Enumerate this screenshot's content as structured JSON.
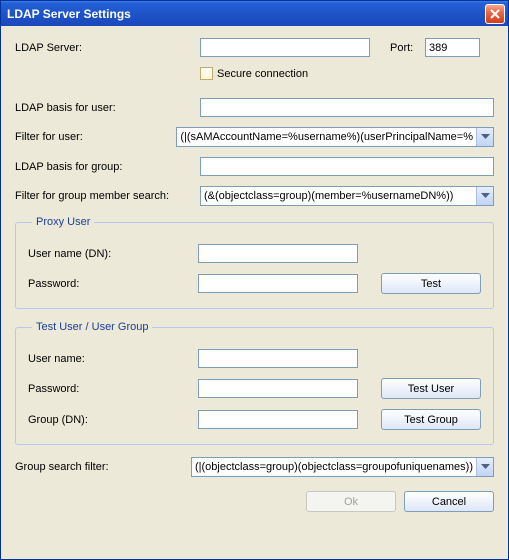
{
  "window": {
    "title": "LDAP Server Settings"
  },
  "server": {
    "label": "LDAP Server:",
    "value": "",
    "portLabel": "Port:",
    "portValue": "389",
    "secureLabel": "Secure connection"
  },
  "fields": {
    "basisUserLabel": "LDAP basis for user:",
    "basisUserValue": "",
    "filterUserLabel": "Filter for user:",
    "filterUserValue": "(|(sAMAccountName=%username%)(userPrincipalName=%",
    "basisGroupLabel": "LDAP basis for group:",
    "basisGroupValue": "",
    "filterGroupMemberLabel": "Filter for group member search:",
    "filterGroupMemberValue": "(&(objectclass=group)(member=%usernameDN%))"
  },
  "proxy": {
    "legend": "Proxy User",
    "userLabel": "User name (DN):",
    "userValue": "",
    "passLabel": "Password:",
    "passValue": "",
    "testLabel": "Test"
  },
  "test": {
    "legend": "Test User / User Group",
    "userLabel": "User name:",
    "userValue": "",
    "passLabel": "Password:",
    "passValue": "",
    "groupLabel": "Group (DN):",
    "groupValue": "",
    "testUserLabel": "Test User",
    "testGroupLabel": "Test Group"
  },
  "groupSearch": {
    "label": "Group search filter:",
    "value": "(|(objectclass=group)(objectclass=groupofuniquenames))"
  },
  "buttons": {
    "ok": "Ok",
    "cancel": "Cancel"
  }
}
